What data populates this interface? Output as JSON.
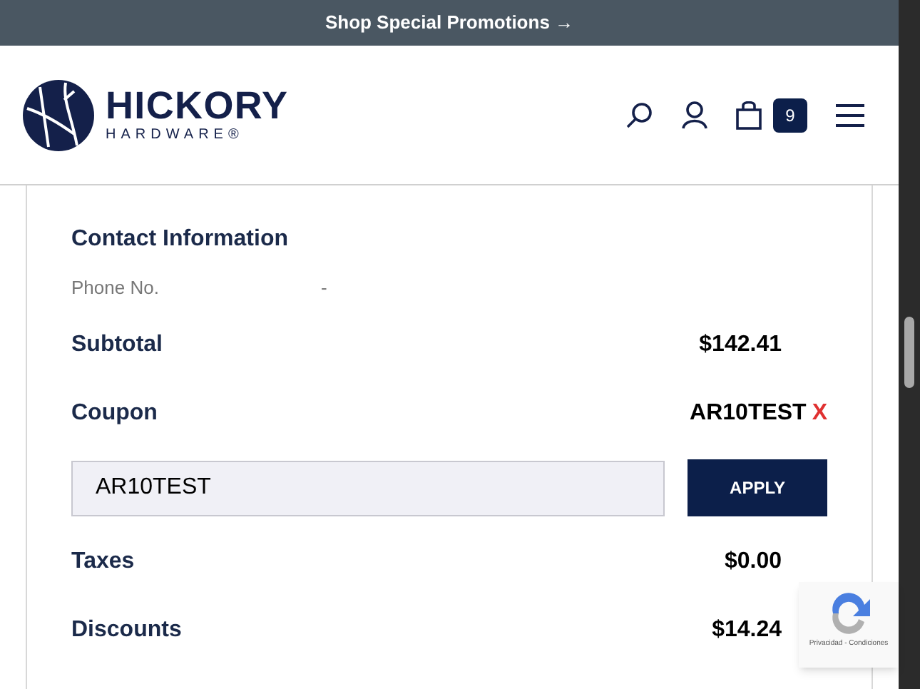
{
  "promo_bar": {
    "text": "Shop Special Promotions →"
  },
  "header": {
    "logo": {
      "name": "HICKORY",
      "tagline": "HARDWARE®"
    },
    "cart_count": "9"
  },
  "contact": {
    "heading": "Contact Information",
    "phone_label": "Phone No.",
    "phone_value": "-"
  },
  "summary_rows": [
    {
      "kind": "amount",
      "label": "Subtotal",
      "value": "$142.41"
    },
    {
      "kind": "coupon",
      "label": "Coupon",
      "value": "AR10TEST",
      "remove": "X"
    },
    {
      "kind": "coupon_form",
      "value": "AR10TEST",
      "button": "APPLY"
    },
    {
      "kind": "amount",
      "label": "Taxes",
      "value": "$0.00"
    },
    {
      "kind": "amount",
      "label": "Discounts",
      "value": "$14.24"
    }
  ],
  "recaptcha": {
    "text": "Privacidad - Condiciones"
  }
}
